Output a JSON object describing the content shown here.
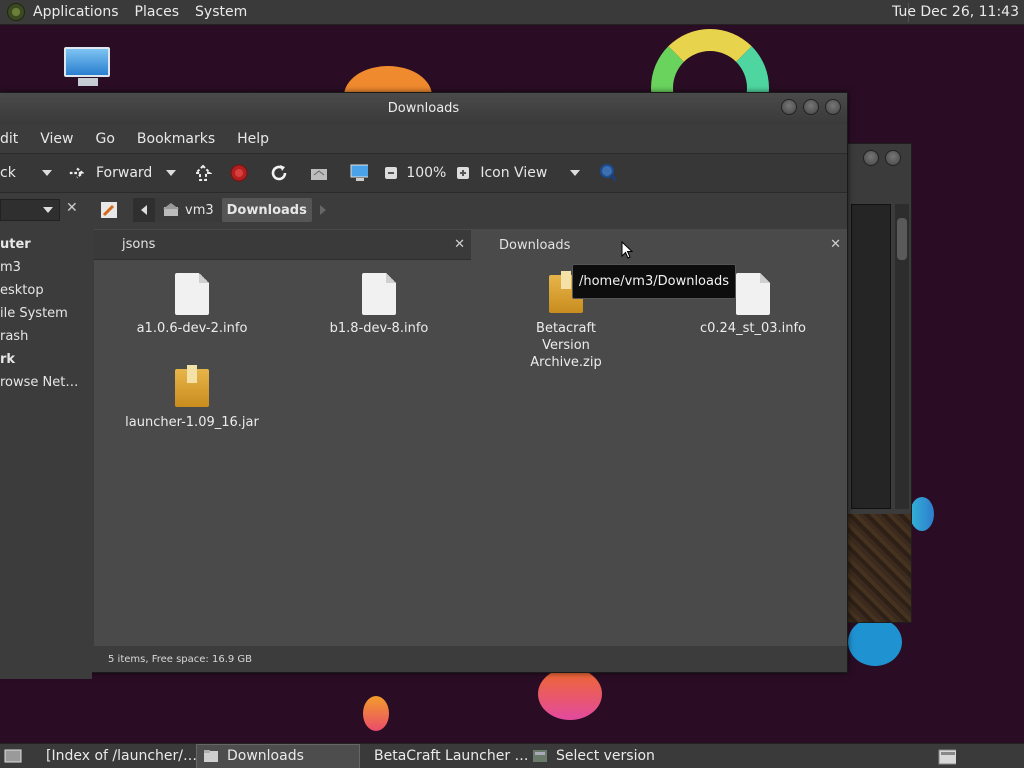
{
  "top_panel": {
    "menus": [
      "Applications",
      "Places",
      "System"
    ],
    "clock": "Tue Dec 26, 11:43"
  },
  "window": {
    "title": "Downloads",
    "menubar": [
      "dit",
      "View",
      "Go",
      "Bookmarks",
      "Help"
    ],
    "toolbar": {
      "back_label": "ck",
      "forward_label": "Forward",
      "zoom": "100%",
      "view_mode": "Icon View"
    },
    "location": {
      "crumb_parent": "vm3",
      "crumb_current": "Downloads"
    },
    "sidebar": {
      "items": [
        {
          "label": "uter",
          "head": true
        },
        {
          "label": "m3",
          "head": false
        },
        {
          "label": "esktop",
          "head": false
        },
        {
          "label": "ile System",
          "head": false
        },
        {
          "label": "rash",
          "head": false
        },
        {
          "label": "rk",
          "head": true
        },
        {
          "label": "rowse Net…",
          "head": false
        }
      ]
    },
    "tabs": [
      {
        "label": "jsons",
        "active": false
      },
      {
        "label": "Downloads",
        "active": true
      }
    ],
    "files": [
      {
        "name": "a1.0.6-dev-2.info",
        "type": "doc"
      },
      {
        "name": "b1.8-dev-8.info",
        "type": "doc"
      },
      {
        "name": "Betacraft Version Archive.zip",
        "type": "pkg"
      },
      {
        "name": "c0.24_st_03.info",
        "type": "doc"
      },
      {
        "name": "launcher-1.09_16.jar",
        "type": "pkg"
      }
    ],
    "tooltip": "/home/vm3/Downloads",
    "status": "5 items, Free space: 16.9 GB"
  },
  "taskbar": {
    "items": [
      {
        "label": "[Index of /launcher/…",
        "active": false,
        "icon": "chrome-icon"
      },
      {
        "label": "Downloads",
        "active": true,
        "icon": "folder-icon"
      },
      {
        "label": "BetaCraft Launcher …",
        "active": false,
        "icon": "java-icon"
      },
      {
        "label": "Select version",
        "active": false,
        "icon": "java-icon"
      }
    ]
  }
}
